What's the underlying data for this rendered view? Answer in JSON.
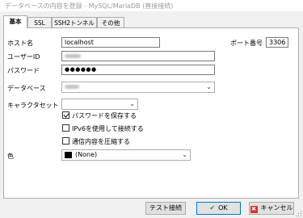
{
  "window": {
    "title": "データベースの内容を登録 - MySQL/MariaDB (直接接続)"
  },
  "tabs": [
    {
      "label": "基本",
      "active": true
    },
    {
      "label": "SSL",
      "active": false
    },
    {
      "label": "SSH2トンネル",
      "active": false
    },
    {
      "label": "その他",
      "active": false
    }
  ],
  "form": {
    "host_label": "ホスト名",
    "host_value": "localhost",
    "port_label": "ポート番号",
    "port_value": "3306",
    "user_label": "ユーザーID",
    "password_label": "パスワード",
    "password_value": "●●●●●●",
    "database_label": "データベース",
    "charset_label": "キャラクタセット",
    "charset_value": "",
    "save_password_label": "パスワードを保存する",
    "save_password_checked": true,
    "ipv6_label": "IPv6を使用して接続する",
    "ipv6_checked": false,
    "compress_label": "通信内容を圧縮する",
    "compress_checked": false,
    "color_label": "色",
    "color_value": "(None)",
    "color_swatch": "#000000"
  },
  "buttons": {
    "test": "テスト接続",
    "ok": "OK",
    "cancel": "キャンセル"
  }
}
